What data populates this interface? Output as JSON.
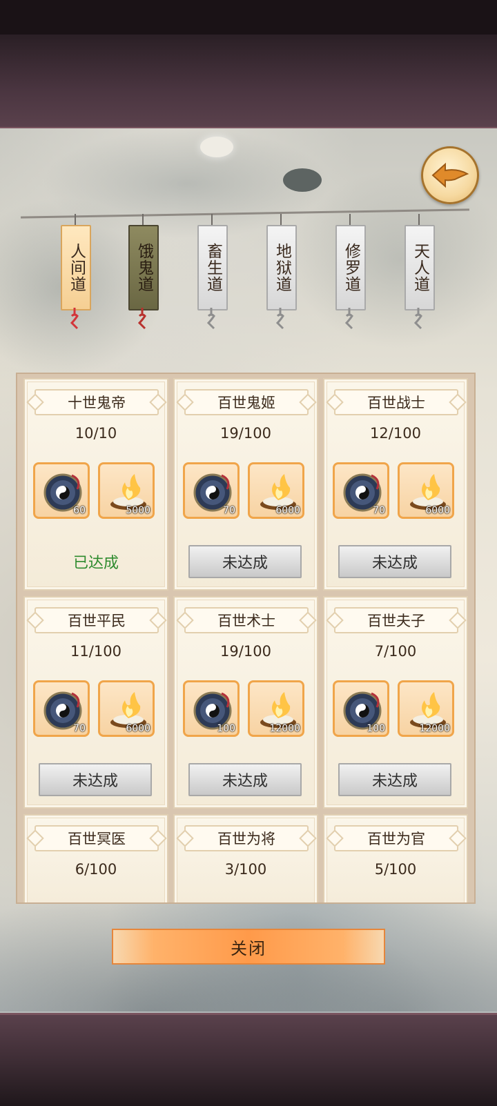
{
  "tabs": [
    {
      "label": "人间道",
      "state": "active"
    },
    {
      "label": "饿鬼道",
      "state": "dark"
    },
    {
      "label": "畜生道",
      "state": "normal"
    },
    {
      "label": "地狱道",
      "state": "normal"
    },
    {
      "label": "修罗道",
      "state": "normal"
    },
    {
      "label": "天人道",
      "state": "normal"
    }
  ],
  "cards": [
    {
      "title": "十世鬼帝",
      "progress": "10/10",
      "reward1_qty": "60",
      "reward2_qty": "5000",
      "status": "已达成",
      "done": true
    },
    {
      "title": "百世鬼姬",
      "progress": "19/100",
      "reward1_qty": "70",
      "reward2_qty": "6000",
      "status": "未达成",
      "done": false
    },
    {
      "title": "百世战士",
      "progress": "12/100",
      "reward1_qty": "70",
      "reward2_qty": "6000",
      "status": "未达成",
      "done": false
    },
    {
      "title": "百世平民",
      "progress": "11/100",
      "reward1_qty": "70",
      "reward2_qty": "6000",
      "status": "未达成",
      "done": false
    },
    {
      "title": "百世术士",
      "progress": "19/100",
      "reward1_qty": "100",
      "reward2_qty": "12000",
      "status": "未达成",
      "done": false
    },
    {
      "title": "百世夫子",
      "progress": "7/100",
      "reward1_qty": "100",
      "reward2_qty": "12000",
      "status": "未达成",
      "done": false
    },
    {
      "title": "百世冥医",
      "progress": "6/100"
    },
    {
      "title": "百世为将",
      "progress": "3/100"
    },
    {
      "title": "百世为官",
      "progress": "5/100"
    }
  ],
  "reward_icons": [
    "yin-yang-compass-icon",
    "incense-flame-icon"
  ],
  "close_label": "关闭",
  "colors": {
    "accent": "#ff9a4a",
    "done_text": "#2e8b2e",
    "tab_active": "#f5cf93"
  }
}
